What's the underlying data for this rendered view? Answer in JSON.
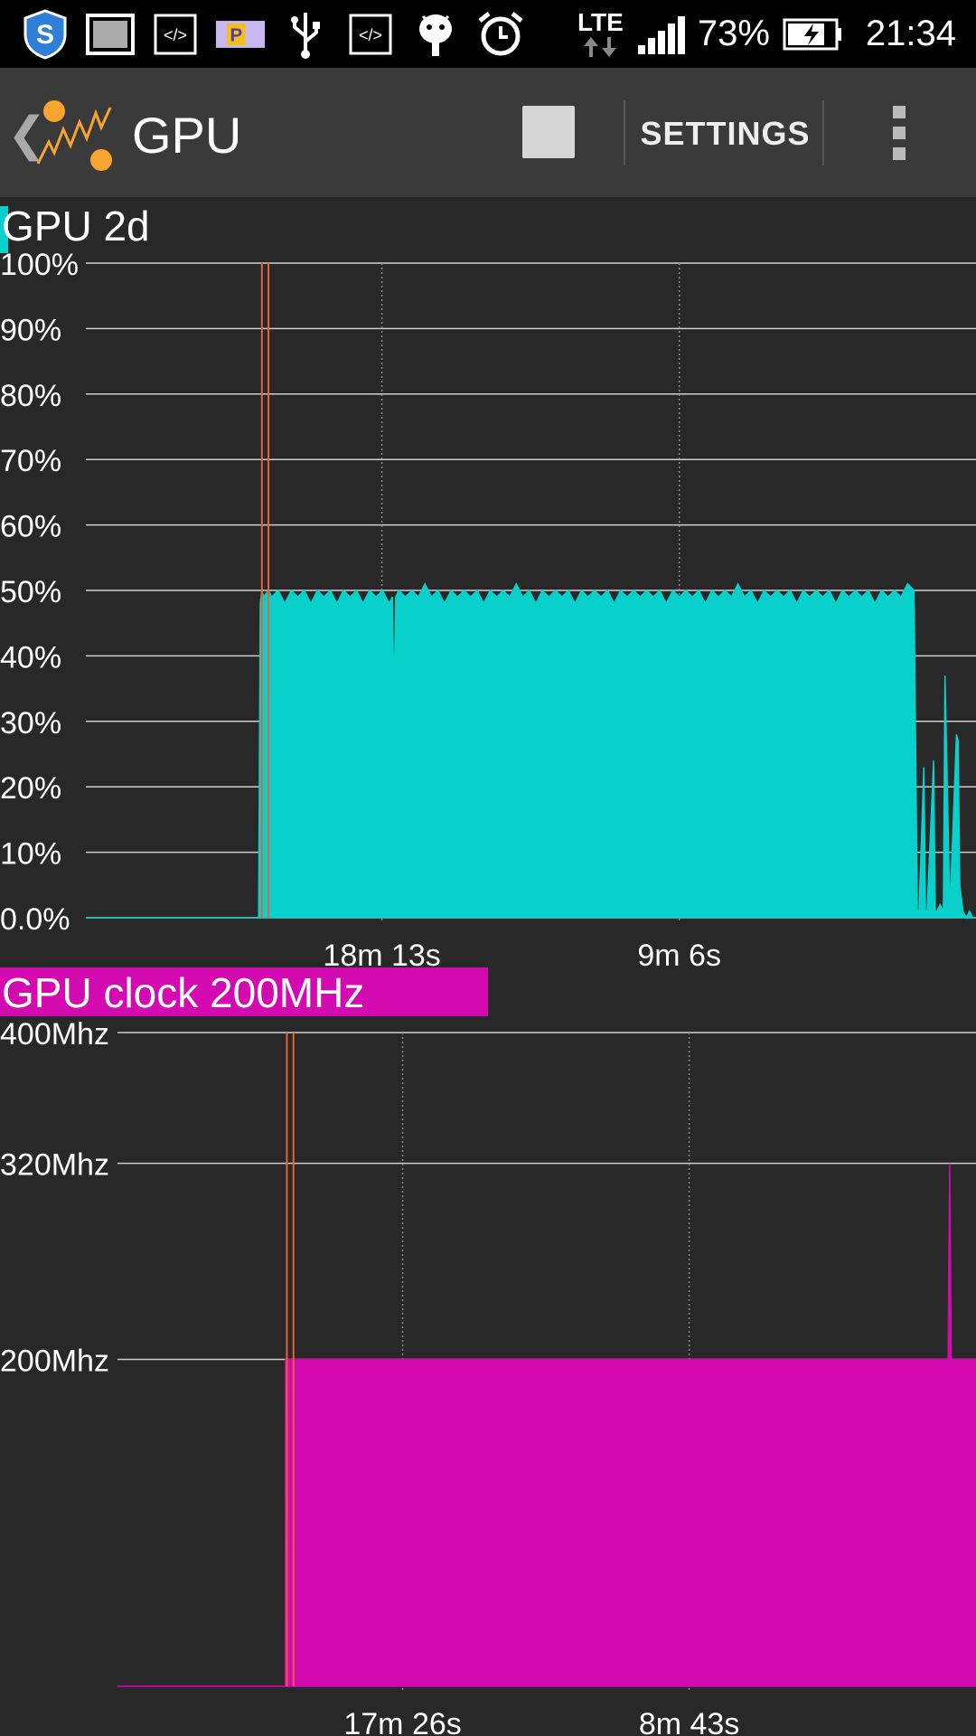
{
  "status_bar": {
    "icons": [
      "shield-icon",
      "image-icon",
      "code-icon",
      "parking-icon",
      "usb-icon",
      "code-icon",
      "android-icon",
      "alarm-icon"
    ],
    "network": "LTE",
    "battery_percent": "73%",
    "time": "21:34"
  },
  "action_bar": {
    "title": "GPU",
    "settings_label": "SETTINGS"
  },
  "colors": {
    "gpu_load": "#0ad0cc",
    "gpu_clock": "#d20ab0",
    "marker": "#e8623a",
    "background": "#282828"
  },
  "chart_data": [
    {
      "type": "area",
      "title": "GPU 2d",
      "ylabels": [
        "100%",
        "90%",
        "80%",
        "70%",
        "60%",
        "50%",
        "40%",
        "30%",
        "20%",
        "10%",
        "0.0%"
      ],
      "ylim": [
        0,
        100
      ],
      "x_ticks": [
        "18m 13s",
        "9m 6s"
      ],
      "x_tick_minutes_ago": [
        18.22,
        9.1
      ],
      "x_range_minutes_ago": [
        27.3,
        0
      ],
      "markers_minutes_ago": [
        21.9,
        21.7
      ],
      "series": [
        {
          "x": [
            27.3,
            22.0,
            21.95,
            21.9,
            21.85,
            21.7,
            21.6,
            21.4,
            21.2,
            21.0,
            20.8,
            20.6,
            20.4,
            20.2,
            20.0,
            19.8,
            19.6,
            19.4,
            19.2,
            19.0,
            18.8,
            18.6,
            18.4,
            18.2,
            18.0,
            17.9,
            17.85,
            17.8,
            17.7,
            17.5,
            17.3,
            17.1,
            16.9,
            16.7,
            16.5,
            16.3,
            16.1,
            15.9,
            15.7,
            15.5,
            15.3,
            15.1,
            14.9,
            14.7,
            14.5,
            14.3,
            14.1,
            13.9,
            13.7,
            13.5,
            13.3,
            13.1,
            12.9,
            12.7,
            12.5,
            12.3,
            12.1,
            11.9,
            11.7,
            11.5,
            11.3,
            11.1,
            10.9,
            10.7,
            10.5,
            10.3,
            10.1,
            9.9,
            9.7,
            9.5,
            9.3,
            9.1,
            8.9,
            8.7,
            8.5,
            8.3,
            8.1,
            7.9,
            7.7,
            7.5,
            7.3,
            7.1,
            6.9,
            6.7,
            6.5,
            6.3,
            6.1,
            5.9,
            5.7,
            5.5,
            5.3,
            5.1,
            4.9,
            4.7,
            4.5,
            4.3,
            4.1,
            3.9,
            3.7,
            3.5,
            3.3,
            3.1,
            2.9,
            2.7,
            2.5,
            2.3,
            2.1,
            1.9,
            1.8,
            1.75,
            1.6,
            1.55,
            1.5,
            1.3,
            1.25,
            1.2,
            1.1,
            1.0,
            0.95,
            0.8,
            0.6,
            0.55,
            0.5,
            0.45,
            0.4,
            0.3,
            0.2,
            0.1,
            0.0
          ],
          "values": [
            0,
            0,
            48,
            50,
            49,
            50,
            49,
            50,
            48,
            50,
            49,
            50,
            48,
            50,
            49,
            50,
            48,
            50,
            49,
            50,
            48,
            50,
            49,
            50,
            48,
            49,
            33,
            49,
            50,
            49,
            50,
            49,
            51,
            49,
            50,
            48,
            50,
            49,
            50,
            49,
            50,
            48,
            50,
            49,
            50,
            49,
            51,
            49,
            50,
            48,
            50,
            49,
            50,
            49,
            50,
            48,
            50,
            49,
            50,
            49,
            50,
            48,
            50,
            49,
            50,
            49,
            50,
            49,
            50,
            48,
            50,
            49,
            50,
            49,
            50,
            48,
            50,
            49,
            50,
            49,
            51,
            49,
            50,
            48,
            50,
            49,
            50,
            49,
            50,
            48,
            50,
            49,
            50,
            49,
            50,
            48,
            50,
            49,
            50,
            49,
            50,
            48,
            50,
            49,
            50,
            49,
            51,
            50,
            1,
            1,
            23,
            1,
            1,
            24,
            1,
            1,
            2,
            1,
            37,
            1,
            28,
            27,
            5,
            3,
            1,
            0,
            1,
            0,
            0
          ]
        }
      ]
    },
    {
      "type": "area",
      "title": "GPU clock 200MHz",
      "ylabels": [
        "400Mhz",
        "320Mhz",
        "200Mhz"
      ],
      "y_tick_values": [
        400,
        320,
        200
      ],
      "ylim": [
        0,
        400
      ],
      "x_ticks": [
        "17m 26s",
        "8m 43s"
      ],
      "x_tick_minutes_ago": [
        17.43,
        8.72
      ],
      "x_range_minutes_ago": [
        26.1,
        0
      ],
      "markers_minutes_ago": [
        20.95,
        20.75
      ],
      "series": [
        {
          "x": [
            26.1,
            21.0,
            20.99,
            0.9,
            0.85,
            0.8,
            0.75,
            0.0
          ],
          "values": [
            0,
            0,
            200,
            200,
            200,
            320,
            200,
            200
          ]
        }
      ]
    }
  ]
}
